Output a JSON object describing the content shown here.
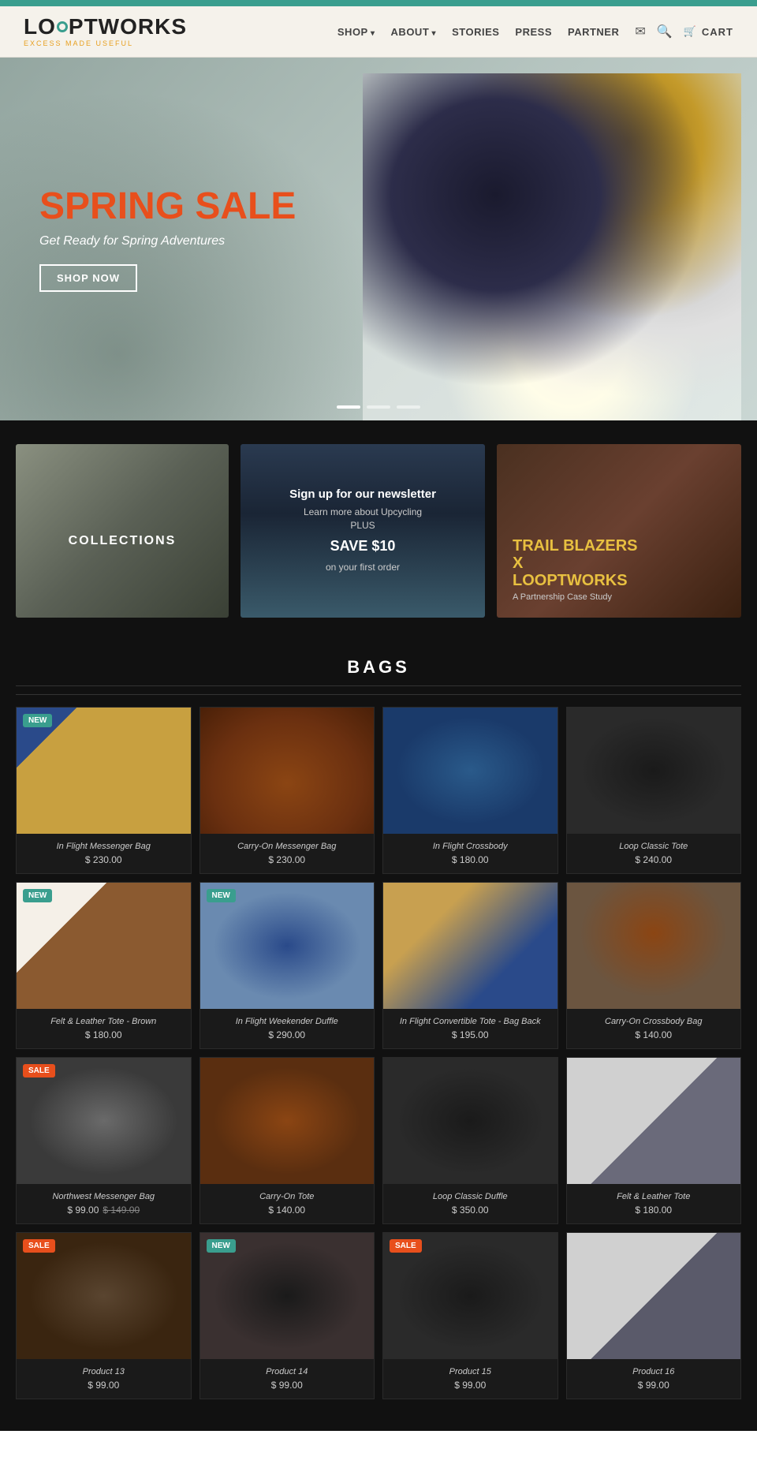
{
  "brand": {
    "name": "LOOPTWORKS",
    "tagline": "EXCESS MADE USEFUL"
  },
  "nav": {
    "shop": "SHOP",
    "about": "ABOUT",
    "stories": "STORIES",
    "press": "PRESS",
    "partner": "PARTNER",
    "cart": "CART"
  },
  "hero": {
    "badge": "SPRING SALE",
    "subtitle": "Get Ready for Spring Adventures",
    "button": "SHOP NOW",
    "dots": [
      true,
      false,
      false
    ]
  },
  "panels": {
    "collections": {
      "label": "COLLECTIONS"
    },
    "newsletter": {
      "heading": "Sign up for our newsletter",
      "line1": "Learn more about Upcycling",
      "plus": "PLUS",
      "save": "SAVE $10",
      "line2": "on your first order"
    },
    "partner": {
      "line1": "TRAIL BLAZERS",
      "x": "X",
      "line2": "LOOPTWORKS",
      "desc": "A Partnership Case Study"
    }
  },
  "bags_section": {
    "title": "BAGS"
  },
  "products": [
    {
      "name": "In Flight Messenger Bag",
      "price": "$ 230.00",
      "original_price": null,
      "badge": "NEW",
      "badge_type": "new",
      "img_class": "prod-img-1"
    },
    {
      "name": "Carry-On Messenger Bag",
      "price": "$ 230.00",
      "original_price": null,
      "badge": null,
      "badge_type": null,
      "img_class": "prod-img-2"
    },
    {
      "name": "In Flight Crossbody",
      "price": "$ 180.00",
      "original_price": null,
      "badge": null,
      "badge_type": null,
      "img_class": "prod-img-3"
    },
    {
      "name": "Loop Classic Tote",
      "price": "$ 240.00",
      "original_price": null,
      "badge": null,
      "badge_type": null,
      "img_class": "prod-img-4"
    },
    {
      "name": "Felt & Leather Tote - Brown",
      "price": "$ 180.00",
      "original_price": null,
      "badge": "NEW",
      "badge_type": "new",
      "img_class": "prod-img-5"
    },
    {
      "name": "In Flight Weekender Duffle",
      "price": "$ 290.00",
      "original_price": null,
      "badge": "NEW",
      "badge_type": "new",
      "img_class": "prod-img-6"
    },
    {
      "name": "In Flight Convertible Tote - Bag Back",
      "price": "$ 195.00",
      "original_price": null,
      "badge": null,
      "badge_type": null,
      "img_class": "prod-img-7"
    },
    {
      "name": "Carry-On Crossbody Bag",
      "price": "$ 140.00",
      "original_price": null,
      "badge": null,
      "badge_type": null,
      "img_class": "prod-img-8"
    },
    {
      "name": "Northwest Messenger Bag",
      "price": "$ 99.00",
      "original_price": "$ 149.00",
      "badge": "SALE",
      "badge_type": "sale",
      "img_class": "prod-img-9"
    },
    {
      "name": "Carry-On Tote",
      "price": "$ 140.00",
      "original_price": null,
      "badge": null,
      "badge_type": null,
      "img_class": "prod-img-10"
    },
    {
      "name": "Loop Classic Duffle",
      "price": "$ 350.00",
      "original_price": null,
      "badge": null,
      "badge_type": null,
      "img_class": "prod-img-11"
    },
    {
      "name": "Felt & Leather Tote",
      "price": "$ 180.00",
      "original_price": null,
      "badge": null,
      "badge_type": null,
      "img_class": "prod-img-12"
    },
    {
      "name": "Product 13",
      "price": "$ 99.00",
      "original_price": null,
      "badge": "SALE",
      "badge_type": "sale",
      "img_class": "prod-img-13"
    },
    {
      "name": "Product 14",
      "price": "$ 99.00",
      "original_price": null,
      "badge": "NEW",
      "badge_type": "new",
      "img_class": "prod-img-14"
    },
    {
      "name": "Product 15",
      "price": "$ 99.00",
      "original_price": null,
      "badge": "SALE",
      "badge_type": "sale",
      "img_class": "prod-img-15"
    },
    {
      "name": "Product 16",
      "price": "$ 99.00",
      "original_price": null,
      "badge": null,
      "badge_type": null,
      "img_class": "prod-img-16"
    }
  ]
}
